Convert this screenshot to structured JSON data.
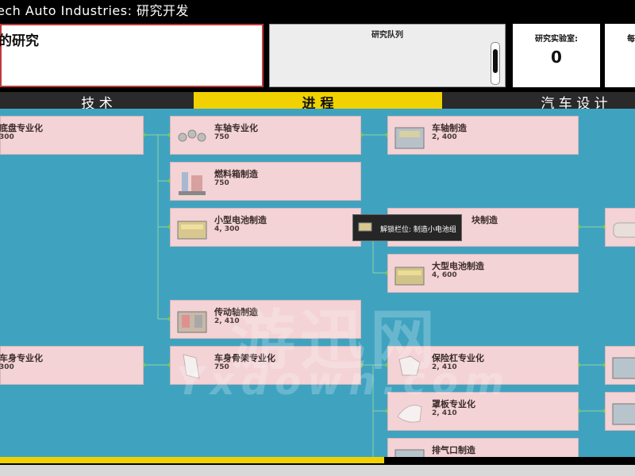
{
  "window": {
    "title": "ech Auto Industries: 研究开发"
  },
  "current_research": {
    "label": "的研究"
  },
  "queue": {
    "label": "研究队列"
  },
  "labs": {
    "label": "研究实验室:",
    "value": "0"
  },
  "extra_panel": {
    "label": "每"
  },
  "tabs": [
    {
      "label": "技 术",
      "active": false
    },
    {
      "label": "进 程",
      "active": true
    },
    {
      "label": "汽 车 设 计",
      "active": false
    }
  ],
  "cards": {
    "chassis_spec": {
      "name": "底盘专业化",
      "cost": "300"
    },
    "axle_spec": {
      "name": "车轴专业化",
      "cost": "750"
    },
    "fuel_tank": {
      "name": "燃料箱制造",
      "cost": "750"
    },
    "small_battery": {
      "name": "小型电池制造",
      "cost": "4, 300"
    },
    "driveshaft": {
      "name": "传动轴制造",
      "cost": "2, 410"
    },
    "axle_mfg": {
      "name": "车轴制造",
      "cost": "2, 400"
    },
    "battery_module": {
      "name": "块制造",
      "cost": ""
    },
    "large_battery": {
      "name": "大型电池制造",
      "cost": "4, 600"
    },
    "body_spec": {
      "name": "车身专业化",
      "cost": "300"
    },
    "body_frame_spec": {
      "name": "车身骨架专业化",
      "cost": "750"
    },
    "bumper_spec": {
      "name": "保险杠专业化",
      "cost": "2, 410"
    },
    "cover_spec": {
      "name": "罩板专业化",
      "cost": "2, 410"
    },
    "exhaust": {
      "name": "排气口制造",
      "cost": ""
    }
  },
  "tooltip": {
    "text": "解锁栏位:  制造小电池组"
  },
  "watermark": {
    "cn": "游迅网",
    "en": "Yxdown.com"
  },
  "progress": {
    "fraction": 0.605
  },
  "colors": {
    "accent": "#f1d200",
    "tree_bg": "#3fa3c0",
    "card": "#f3d3d5",
    "link": "#7ac943"
  }
}
